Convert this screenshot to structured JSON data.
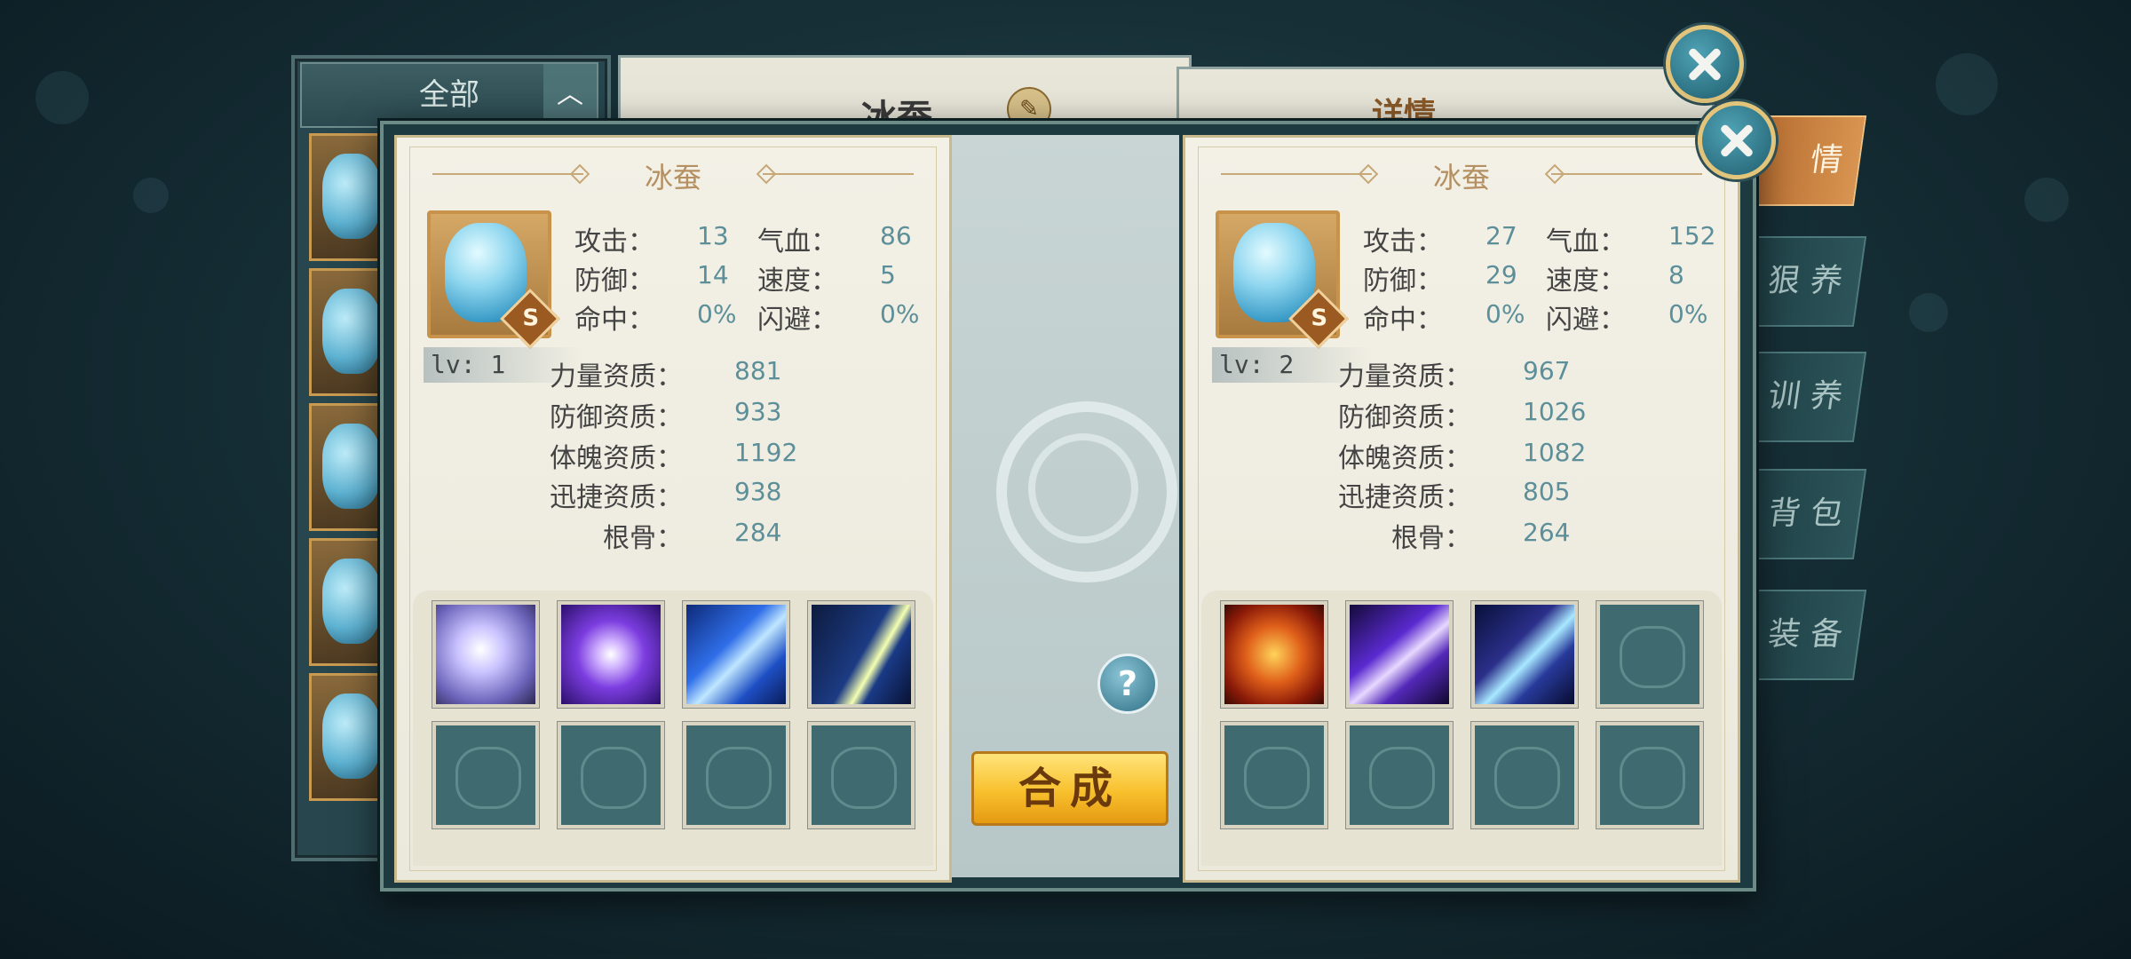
{
  "background": {
    "list_filter_label": "全部",
    "center_title": "冰蚕",
    "detail_title": "详情",
    "side_tabs": [
      "情",
      "狠 养",
      "训 养",
      "背 包",
      "装 备"
    ]
  },
  "dialog": {
    "synthesize_label": "合成",
    "help_label": "?",
    "left_pet": {
      "name": "冰蚕",
      "grade_badge": "S",
      "level_text": "lv: 1",
      "stats": [
        {
          "label": "攻击：",
          "value": "13"
        },
        {
          "label": "气血：",
          "value": "86"
        },
        {
          "label": "防御：",
          "value": "14"
        },
        {
          "label": "速度：",
          "value": "5"
        },
        {
          "label": "命中：",
          "value": "0%"
        },
        {
          "label": "闪避：",
          "value": "0%"
        }
      ],
      "aptitudes": [
        {
          "label": "力量资质：",
          "value": "881"
        },
        {
          "label": "防御资质：",
          "value": "933"
        },
        {
          "label": "体魄资质：",
          "value": "1192"
        },
        {
          "label": "迅捷资质：",
          "value": "938"
        },
        {
          "label": "根骨：",
          "value": "284"
        }
      ],
      "skills": [
        "vortex-skill-icon",
        "lightning-orb-skill-icon",
        "speed-arrow-skill-icon",
        "moon-slash-skill-icon",
        "empty",
        "empty",
        "empty",
        "empty"
      ]
    },
    "right_pet": {
      "name": "冰蚕",
      "grade_badge": "S",
      "level_text": "lv: 2",
      "stats": [
        {
          "label": "攻击：",
          "value": "27"
        },
        {
          "label": "气血：",
          "value": "152"
        },
        {
          "label": "防御：",
          "value": "29"
        },
        {
          "label": "速度：",
          "value": "8"
        },
        {
          "label": "命中：",
          "value": "0%"
        },
        {
          "label": "闪避：",
          "value": "0%"
        }
      ],
      "aptitudes": [
        {
          "label": "力量资质：",
          "value": "967"
        },
        {
          "label": "防御资质：",
          "value": "1026"
        },
        {
          "label": "体魄资质：",
          "value": "1082"
        },
        {
          "label": "迅捷资质：",
          "value": "805"
        },
        {
          "label": "根骨：",
          "value": "264"
        }
      ],
      "skills": [
        "fire-orb-skill-icon",
        "purple-slash-skill-icon",
        "claw-skill-icon",
        "empty",
        "empty",
        "empty",
        "empty",
        "empty"
      ]
    }
  },
  "colors": {
    "stat_value": "#5c8f9a",
    "synth_button": "#f8c02d",
    "panel_bg": "#f3f1e6"
  }
}
